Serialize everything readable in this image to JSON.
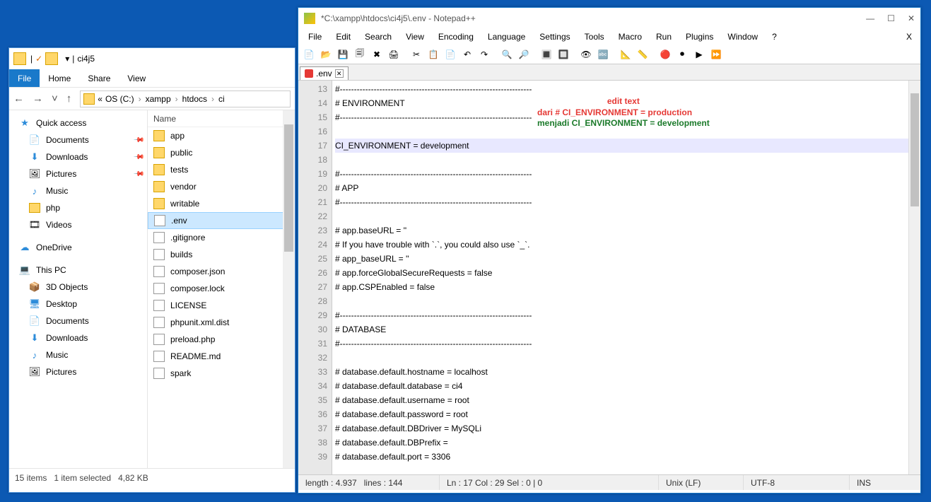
{
  "explorer": {
    "title_parts": {
      "folder": "",
      "chk": "✓",
      "down": "▾",
      "sep": "|",
      "name": "ci4j5"
    },
    "ribbon": {
      "file": "File",
      "home": "Home",
      "share": "Share",
      "view": "View"
    },
    "nav": {
      "back": "←",
      "fwd": "→",
      "drop": "˅",
      "up": "↑"
    },
    "crumbs": {
      "pre": "«",
      "p1": "OS (C:)",
      "p2": "xampp",
      "p3": "htdocs",
      "p4": "ci"
    },
    "header": {
      "name": "Name",
      "caret": "^"
    },
    "nav_pane": [
      {
        "label": "Quick access",
        "icon": "★",
        "color": "#2d8cda",
        "hd": true
      },
      {
        "label": "Documents",
        "icon": "📄",
        "pin": true
      },
      {
        "label": "Downloads",
        "icon": "⬇",
        "pin": true,
        "color": "#2d8cda"
      },
      {
        "label": "Pictures",
        "icon": "🖼",
        "pin": true
      },
      {
        "label": "Music",
        "icon": "♪",
        "color": "#2d8cda"
      },
      {
        "label": "php",
        "icon": "folder"
      },
      {
        "label": "Videos",
        "icon": "🎞"
      },
      {
        "label": "",
        "spacer": true
      },
      {
        "label": "OneDrive",
        "icon": "☁",
        "hd": true,
        "color": "#2d8cda"
      },
      {
        "label": "",
        "spacer": true
      },
      {
        "label": "This PC",
        "icon": "💻",
        "hd": true
      },
      {
        "label": "3D Objects",
        "icon": "📦"
      },
      {
        "label": "Desktop",
        "icon": "🖥",
        "color": "#2d8cda"
      },
      {
        "label": "Documents",
        "icon": "📄"
      },
      {
        "label": "Downloads",
        "icon": "⬇",
        "color": "#2d8cda"
      },
      {
        "label": "Music",
        "icon": "♪",
        "color": "#2d8cda"
      },
      {
        "label": "Pictures",
        "icon": "🖼",
        "cut": true
      }
    ],
    "files": [
      {
        "name": "app",
        "type": "folder"
      },
      {
        "name": "public",
        "type": "folder"
      },
      {
        "name": "tests",
        "type": "folder"
      },
      {
        "name": "vendor",
        "type": "folder"
      },
      {
        "name": "writable",
        "type": "folder"
      },
      {
        "name": ".env",
        "type": "file",
        "sel": true
      },
      {
        "name": ".gitignore",
        "type": "file"
      },
      {
        "name": "builds",
        "type": "file"
      },
      {
        "name": "composer.json",
        "type": "file"
      },
      {
        "name": "composer.lock",
        "type": "file"
      },
      {
        "name": "LICENSE",
        "type": "file"
      },
      {
        "name": "phpunit.xml.dist",
        "type": "file"
      },
      {
        "name": "preload.php",
        "type": "file"
      },
      {
        "name": "README.md",
        "type": "file"
      },
      {
        "name": "spark",
        "type": "file"
      }
    ],
    "status": {
      "items": "15 items",
      "sel": "1 item selected",
      "size": "4,82 KB"
    }
  },
  "npp": {
    "title": "*C:\\xampp\\htdocs\\ci4j5\\.env - Notepad++",
    "winbtns": {
      "min": "—",
      "max": "☐",
      "close": "✕"
    },
    "menu": [
      "File",
      "Edit",
      "Search",
      "View",
      "Encoding",
      "Language",
      "Settings",
      "Tools",
      "Macro",
      "Run",
      "Plugins",
      "Window",
      "?"
    ],
    "menu_x": "X",
    "tab": {
      "name": ".env",
      "close": "✕"
    },
    "lines": [
      {
        "n": 13,
        "t": "#--------------------------------------------------------------------"
      },
      {
        "n": 14,
        "t": "# ENVIRONMENT"
      },
      {
        "n": 15,
        "t": "#--------------------------------------------------------------------"
      },
      {
        "n": 16,
        "t": ""
      },
      {
        "n": 17,
        "t": "CI_ENVIRONMENT = development",
        "hl": true
      },
      {
        "n": 18,
        "t": ""
      },
      {
        "n": 19,
        "t": "#--------------------------------------------------------------------"
      },
      {
        "n": 20,
        "t": "# APP"
      },
      {
        "n": 21,
        "t": "#--------------------------------------------------------------------"
      },
      {
        "n": 22,
        "t": ""
      },
      {
        "n": 23,
        "t": "# app.baseURL = ''"
      },
      {
        "n": 24,
        "t": "# If you have trouble with `.`, you could also use `_`."
      },
      {
        "n": 25,
        "t": "# app_baseURL = ''"
      },
      {
        "n": 26,
        "t": "# app.forceGlobalSecureRequests = false"
      },
      {
        "n": 27,
        "t": "# app.CSPEnabled = false"
      },
      {
        "n": 28,
        "t": ""
      },
      {
        "n": 29,
        "t": "#--------------------------------------------------------------------"
      },
      {
        "n": 30,
        "t": "# DATABASE"
      },
      {
        "n": 31,
        "t": "#--------------------------------------------------------------------"
      },
      {
        "n": 32,
        "t": ""
      },
      {
        "n": 33,
        "t": "# database.default.hostname = localhost"
      },
      {
        "n": 34,
        "t": "# database.default.database = ci4"
      },
      {
        "n": 35,
        "t": "# database.default.username = root"
      },
      {
        "n": 36,
        "t": "# database.default.password = root"
      },
      {
        "n": 37,
        "t": "# database.default.DBDriver = MySQLi"
      },
      {
        "n": 38,
        "t": "# database.default.DBPrefix ="
      },
      {
        "n": 39,
        "t": "# database.default.port = 3306"
      }
    ],
    "status": {
      "len": "length : 4.937",
      "lines": "lines : 144",
      "pos": "Ln : 17   Col : 29   Sel : 0 | 0",
      "eol": "Unix (LF)",
      "enc": "UTF-8",
      "ins": "INS"
    },
    "annot": {
      "a1": "edit text",
      "a2": "dari # CI_ENVIRONMENT = production",
      "a3": "menjadi CI_ENVIRONMENT = development"
    },
    "toolbar_icons": [
      "📄",
      "📂",
      "💾",
      "🗐",
      "✖",
      "🖨",
      "",
      "✂",
      "📋",
      "📄",
      "↶",
      "↷",
      "",
      "🔍",
      "🔎",
      "",
      "🔳",
      "🔲",
      "",
      "👁",
      "🔤",
      "",
      "📐",
      "📏",
      "",
      "🔴",
      "⏺",
      "▶",
      "⏩"
    ]
  }
}
